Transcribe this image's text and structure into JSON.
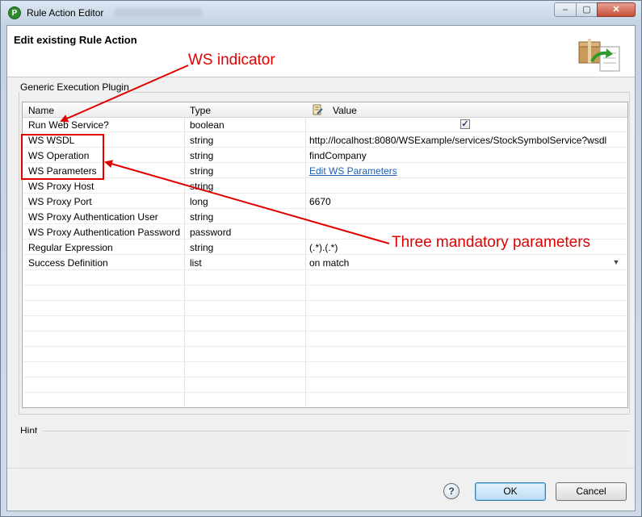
{
  "window": {
    "title": "Rule Action Editor",
    "controls": {
      "minimize": "–",
      "maximize": "▢",
      "close": "✕"
    }
  },
  "header": {
    "title": "Edit existing Rule Action",
    "icon": "package-refresh-icon"
  },
  "group": {
    "label": "Generic Execution Plugin"
  },
  "table": {
    "columns": {
      "name": "Name",
      "type": "Type",
      "value": "Value"
    },
    "rows": [
      {
        "name": "Run Web Service?",
        "type": "boolean",
        "value": "",
        "checked": true
      },
      {
        "name": "WS WSDL",
        "type": "string",
        "value": "http://localhost:8080/WSExample/services/StockSymbolService?wsdl"
      },
      {
        "name": "WS Operation",
        "type": "string",
        "value": "findCompany"
      },
      {
        "name": "WS Parameters",
        "type": "string",
        "value": "Edit WS Parameters"
      },
      {
        "name": "WS Proxy Host",
        "type": "string",
        "value": ""
      },
      {
        "name": "WS Proxy Port",
        "type": "long",
        "value": "6670"
      },
      {
        "name": "WS Proxy Authentication User",
        "type": "string",
        "value": ""
      },
      {
        "name": "WS Proxy Authentication Password",
        "type": "password",
        "value": ""
      },
      {
        "name": "Regular Expression",
        "type": "string",
        "value": "(.*).(.*)"
      },
      {
        "name": "Success Definition",
        "type": "list",
        "value": "on match"
      }
    ]
  },
  "hint": {
    "label": "Hint"
  },
  "buttons": {
    "help": "?",
    "ok": "OK",
    "cancel": "Cancel"
  },
  "annotations": {
    "ws_indicator": "WS indicator",
    "mandatory": "Three mandatory parameters",
    "color": "#e00000"
  }
}
